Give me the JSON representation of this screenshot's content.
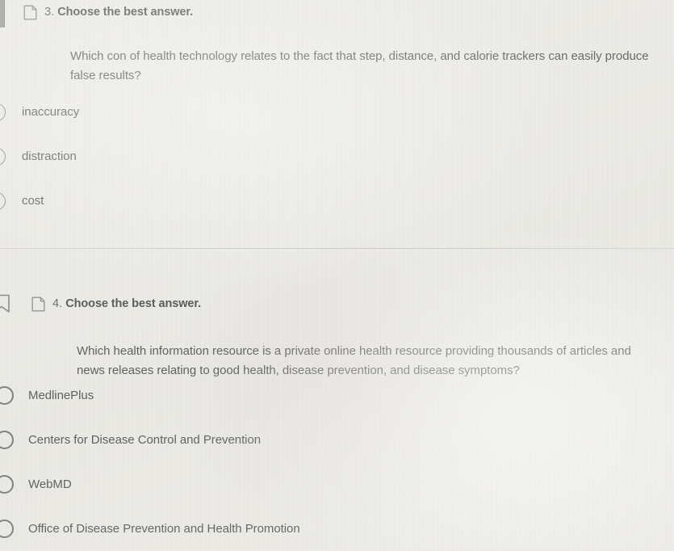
{
  "page": {
    "background_color": "#ecebe6",
    "text_color": "#3c3e40"
  },
  "divider": {
    "present": true
  },
  "questions": [
    {
      "number": "3.",
      "title": "Choose the best answer.",
      "icon": "note-page-icon",
      "stem": "Which con of health technology relates to the fact that step, distance, and calorie trackers can easily produce false results?",
      "options": [
        {
          "label": "inaccuracy",
          "selected": false
        },
        {
          "label": "distraction",
          "selected": false
        },
        {
          "label": "cost",
          "selected": false
        }
      ]
    },
    {
      "number": "4.",
      "title": "Choose the best answer.",
      "icon": "note-page-icon",
      "bookmark_icon": "bookmark-icon",
      "stem": "Which health information resource is a private online health resource providing thousands of articles and news releases relating to good health, disease prevention, and disease symptoms?",
      "options": [
        {
          "label": "MedlinePlus",
          "selected": false
        },
        {
          "label": "Centers for Disease Control and Prevention",
          "selected": false
        },
        {
          "label": "WebMD",
          "selected": false
        },
        {
          "label": "Office of Disease Prevention and Health Promotion",
          "selected": false
        }
      ]
    }
  ]
}
